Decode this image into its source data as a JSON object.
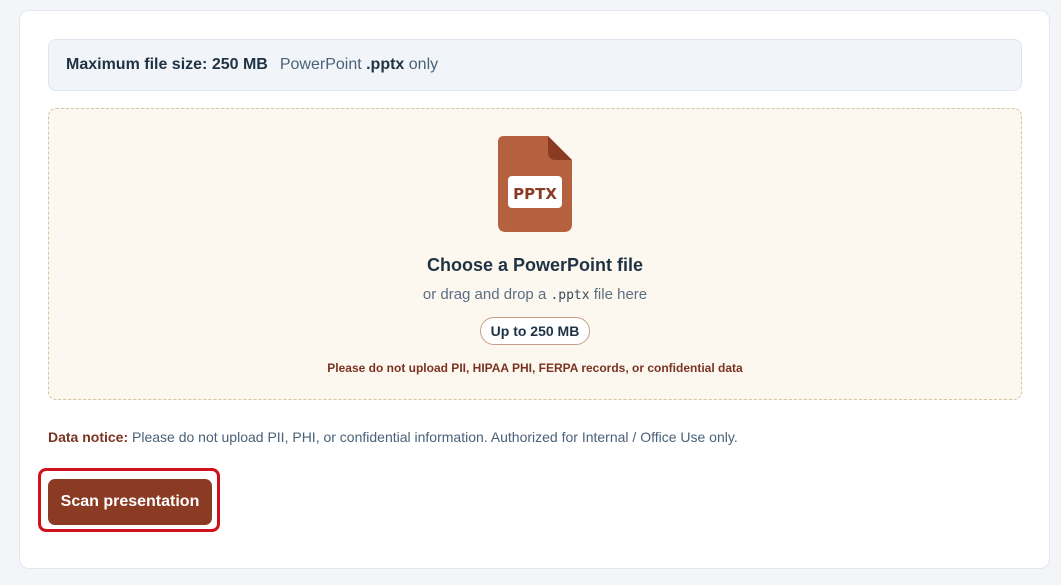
{
  "info_bar": {
    "max_size": "Maximum file size: 250 MB",
    "type_prefix": "PowerPoint ",
    "type_ext": ".pptx",
    "type_suffix": " only"
  },
  "dropzone": {
    "icon_label": "PPTX",
    "title": "Choose a PowerPoint file",
    "sub_prefix": "or drag and drop a ",
    "sub_code": ".pptx",
    "sub_suffix": " file here",
    "size_pill": "Up to 250 MB",
    "warning": "Please do not upload PII, HIPAA PHI, FERPA records, or confidential data"
  },
  "notice": {
    "label": "Data notice:",
    "text": " Please do not upload PII, PHI, or confidential information. Authorized for Internal / Office Use only."
  },
  "actions": {
    "scan_label": "Scan presentation"
  },
  "colors": {
    "accent": "#8b3a24",
    "file_icon": "#b5603f",
    "file_fold": "#8b3a24",
    "highlight": "#d0101a"
  }
}
